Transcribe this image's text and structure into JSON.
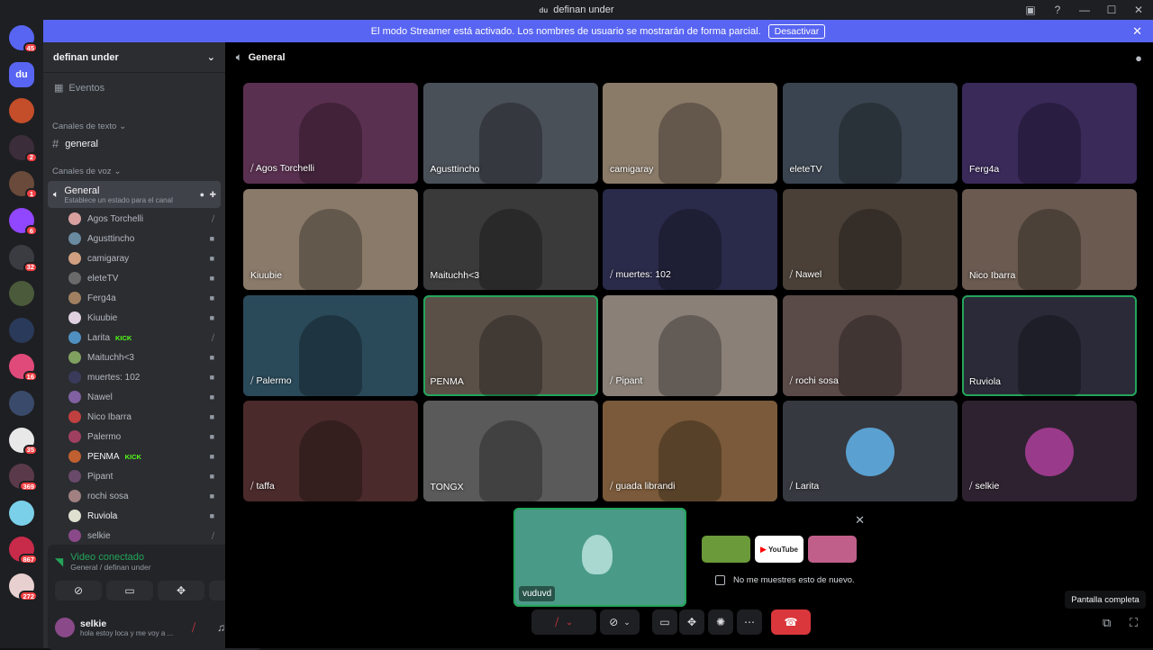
{
  "window": {
    "title": "definan under",
    "icon_text": "du"
  },
  "banner": {
    "text": "El modo Streamer está activado. Los nombres de usuario se mostrarán de forma parcial.",
    "button_label": "Desactivar"
  },
  "servers": [
    {
      "label": "",
      "badge": "45",
      "color": "#5865f2"
    },
    {
      "label": "du",
      "badge": "",
      "color": "#5865f2"
    },
    {
      "label": "",
      "badge": "",
      "color": "#c44d2a"
    },
    {
      "label": "",
      "badge": "2",
      "color": "#3b2d3a"
    },
    {
      "label": "",
      "badge": "1",
      "color": "#6a4a3a"
    },
    {
      "label": "",
      "badge": "6",
      "color": "#9146ff"
    },
    {
      "label": "",
      "badge": "32",
      "color": "#3a3c42"
    },
    {
      "label": "",
      "badge": "",
      "color": "#4a5a3a"
    },
    {
      "label": "",
      "badge": "",
      "color": "#2a3a5a"
    },
    {
      "label": "",
      "badge": "16",
      "color": "#e04a7a"
    },
    {
      "label": "",
      "badge": "",
      "color": "#3a4a6a"
    },
    {
      "label": "",
      "badge": "35",
      "color": "#e8e8e8"
    },
    {
      "label": "",
      "badge": "369",
      "color": "#5a3a4a"
    },
    {
      "label": "",
      "badge": "",
      "color": "#7ad0e8"
    },
    {
      "label": "",
      "badge": "867",
      "color": "#c82a4a"
    },
    {
      "label": "",
      "badge": "272",
      "color": "#e8d0d0"
    }
  ],
  "sidebar": {
    "guild_name": "definan under",
    "events_label": "Eventos",
    "text_category": "Canales de texto",
    "text_channel": "general",
    "voice_category": "Canales de voz",
    "voice_channel": "General",
    "voice_status": "Establece un estado para el canal",
    "members": [
      {
        "name": "Agos Torchelli",
        "icon": "mic-muted-icon",
        "kick": "",
        "color": "#d9a0a0"
      },
      {
        "name": "Agusttincho",
        "icon": "video-icon",
        "kick": "",
        "color": "#6a8aa0"
      },
      {
        "name": "camigaray",
        "icon": "video-icon",
        "kick": "",
        "color": "#d0a080"
      },
      {
        "name": "eleteTV",
        "icon": "video-icon",
        "kick": "",
        "color": "#6a6a6a"
      },
      {
        "name": "Ferg4a",
        "icon": "video-icon",
        "kick": "",
        "color": "#a08060"
      },
      {
        "name": "Kiuubie",
        "icon": "video-icon",
        "kick": "",
        "color": "#e0d0e0"
      },
      {
        "name": "Larita",
        "icon": "mic-muted-icon",
        "kick": "KICK",
        "color": "#5090c0"
      },
      {
        "name": "Maituchh<3",
        "icon": "video-icon",
        "kick": "",
        "color": "#80a060"
      },
      {
        "name": "muertes: 102",
        "icon": "video-icon",
        "kick": "",
        "color": "#3a3a5a"
      },
      {
        "name": "Nawel",
        "icon": "video-icon",
        "kick": "",
        "color": "#8060a0"
      },
      {
        "name": "Nico Ibarra",
        "icon": "video-icon",
        "kick": "",
        "color": "#c04040"
      },
      {
        "name": "Palermo",
        "icon": "video-icon",
        "kick": "",
        "color": "#a04060"
      },
      {
        "name": "PENMA",
        "icon": "video-icon",
        "kick": "KICK",
        "color": "#c06030"
      },
      {
        "name": "Pipant",
        "icon": "video-icon",
        "kick": "",
        "color": "#6a4a6a"
      },
      {
        "name": "rochi sosa",
        "icon": "video-icon",
        "kick": "",
        "color": "#a08080"
      },
      {
        "name": "Ruviola",
        "icon": "video-icon",
        "kick": "",
        "color": "#e0e0d0"
      },
      {
        "name": "selkie",
        "icon": "mic-muted-icon",
        "kick": "",
        "color": "#8a4a8a"
      }
    ],
    "voice_connected_label": "Video conectado",
    "voice_connected_sub": "General / definan under",
    "user_name": "selkie",
    "user_status": "hola estoy loca y me voy a ..."
  },
  "main": {
    "channel_title": "General",
    "tiles": [
      {
        "name": "Agos Torchelli",
        "muted": true,
        "speaking": false,
        "bg": "#5a3050"
      },
      {
        "name": "Agusttincho",
        "muted": false,
        "speaking": false,
        "bg": "#4a5058"
      },
      {
        "name": "camigaray",
        "muted": false,
        "speaking": false,
        "bg": "#8a7a68"
      },
      {
        "name": "eleteTV",
        "muted": false,
        "speaking": false,
        "bg": "#3a4450"
      },
      {
        "name": "Ferg4a",
        "muted": false,
        "speaking": false,
        "bg": "#3a2a5a"
      },
      {
        "name": "Kiuubie",
        "muted": false,
        "speaking": false,
        "bg": "#8a7a6a"
      },
      {
        "name": "Maituchh<3",
        "muted": false,
        "speaking": false,
        "bg": "#3a3a3a"
      },
      {
        "name": "muertes: 102",
        "muted": true,
        "speaking": false,
        "bg": "#2a2a4a"
      },
      {
        "name": "Nawel",
        "muted": true,
        "speaking": false,
        "bg": "#4a4038"
      },
      {
        "name": "Nico Ibarra",
        "muted": false,
        "speaking": false,
        "bg": "#6a5a50"
      },
      {
        "name": "Palermo",
        "muted": true,
        "speaking": false,
        "bg": "#2a4a5a"
      },
      {
        "name": "PENMA",
        "muted": false,
        "speaking": true,
        "bg": "#5a5048"
      },
      {
        "name": "Pipant",
        "muted": true,
        "speaking": false,
        "bg": "#8a8078"
      },
      {
        "name": "rochi sosa",
        "muted": true,
        "speaking": false,
        "bg": "#5a4a48"
      },
      {
        "name": "Ruviola",
        "muted": false,
        "speaking": true,
        "bg": "#2a2a38"
      },
      {
        "name": "taffa",
        "muted": true,
        "speaking": false,
        "bg": "#4a2a2a"
      },
      {
        "name": "TONGX",
        "muted": false,
        "speaking": false,
        "bg": "#5a5a5a"
      },
      {
        "name": "guada librandi",
        "muted": true,
        "speaking": false,
        "bg": "#7a5a3a"
      },
      {
        "name": "Larita",
        "muted": true,
        "speaking": false,
        "bg": "#36393f",
        "avatar": "#5aa0d0"
      },
      {
        "name": "selkie",
        "muted": true,
        "speaking": false,
        "bg": "#2e2230",
        "avatar": "#9a3a8a"
      }
    ],
    "self_preview_name": "vuduvd",
    "checkbox_label": "No me muestres esto de nuevo.",
    "youtube_label": "YouTube",
    "fullscreen_tooltip": "Pantalla completa"
  },
  "colors": {
    "blurple": "#5865f2",
    "green": "#23a55a",
    "red": "#da373c",
    "kick": "#53fc18"
  }
}
